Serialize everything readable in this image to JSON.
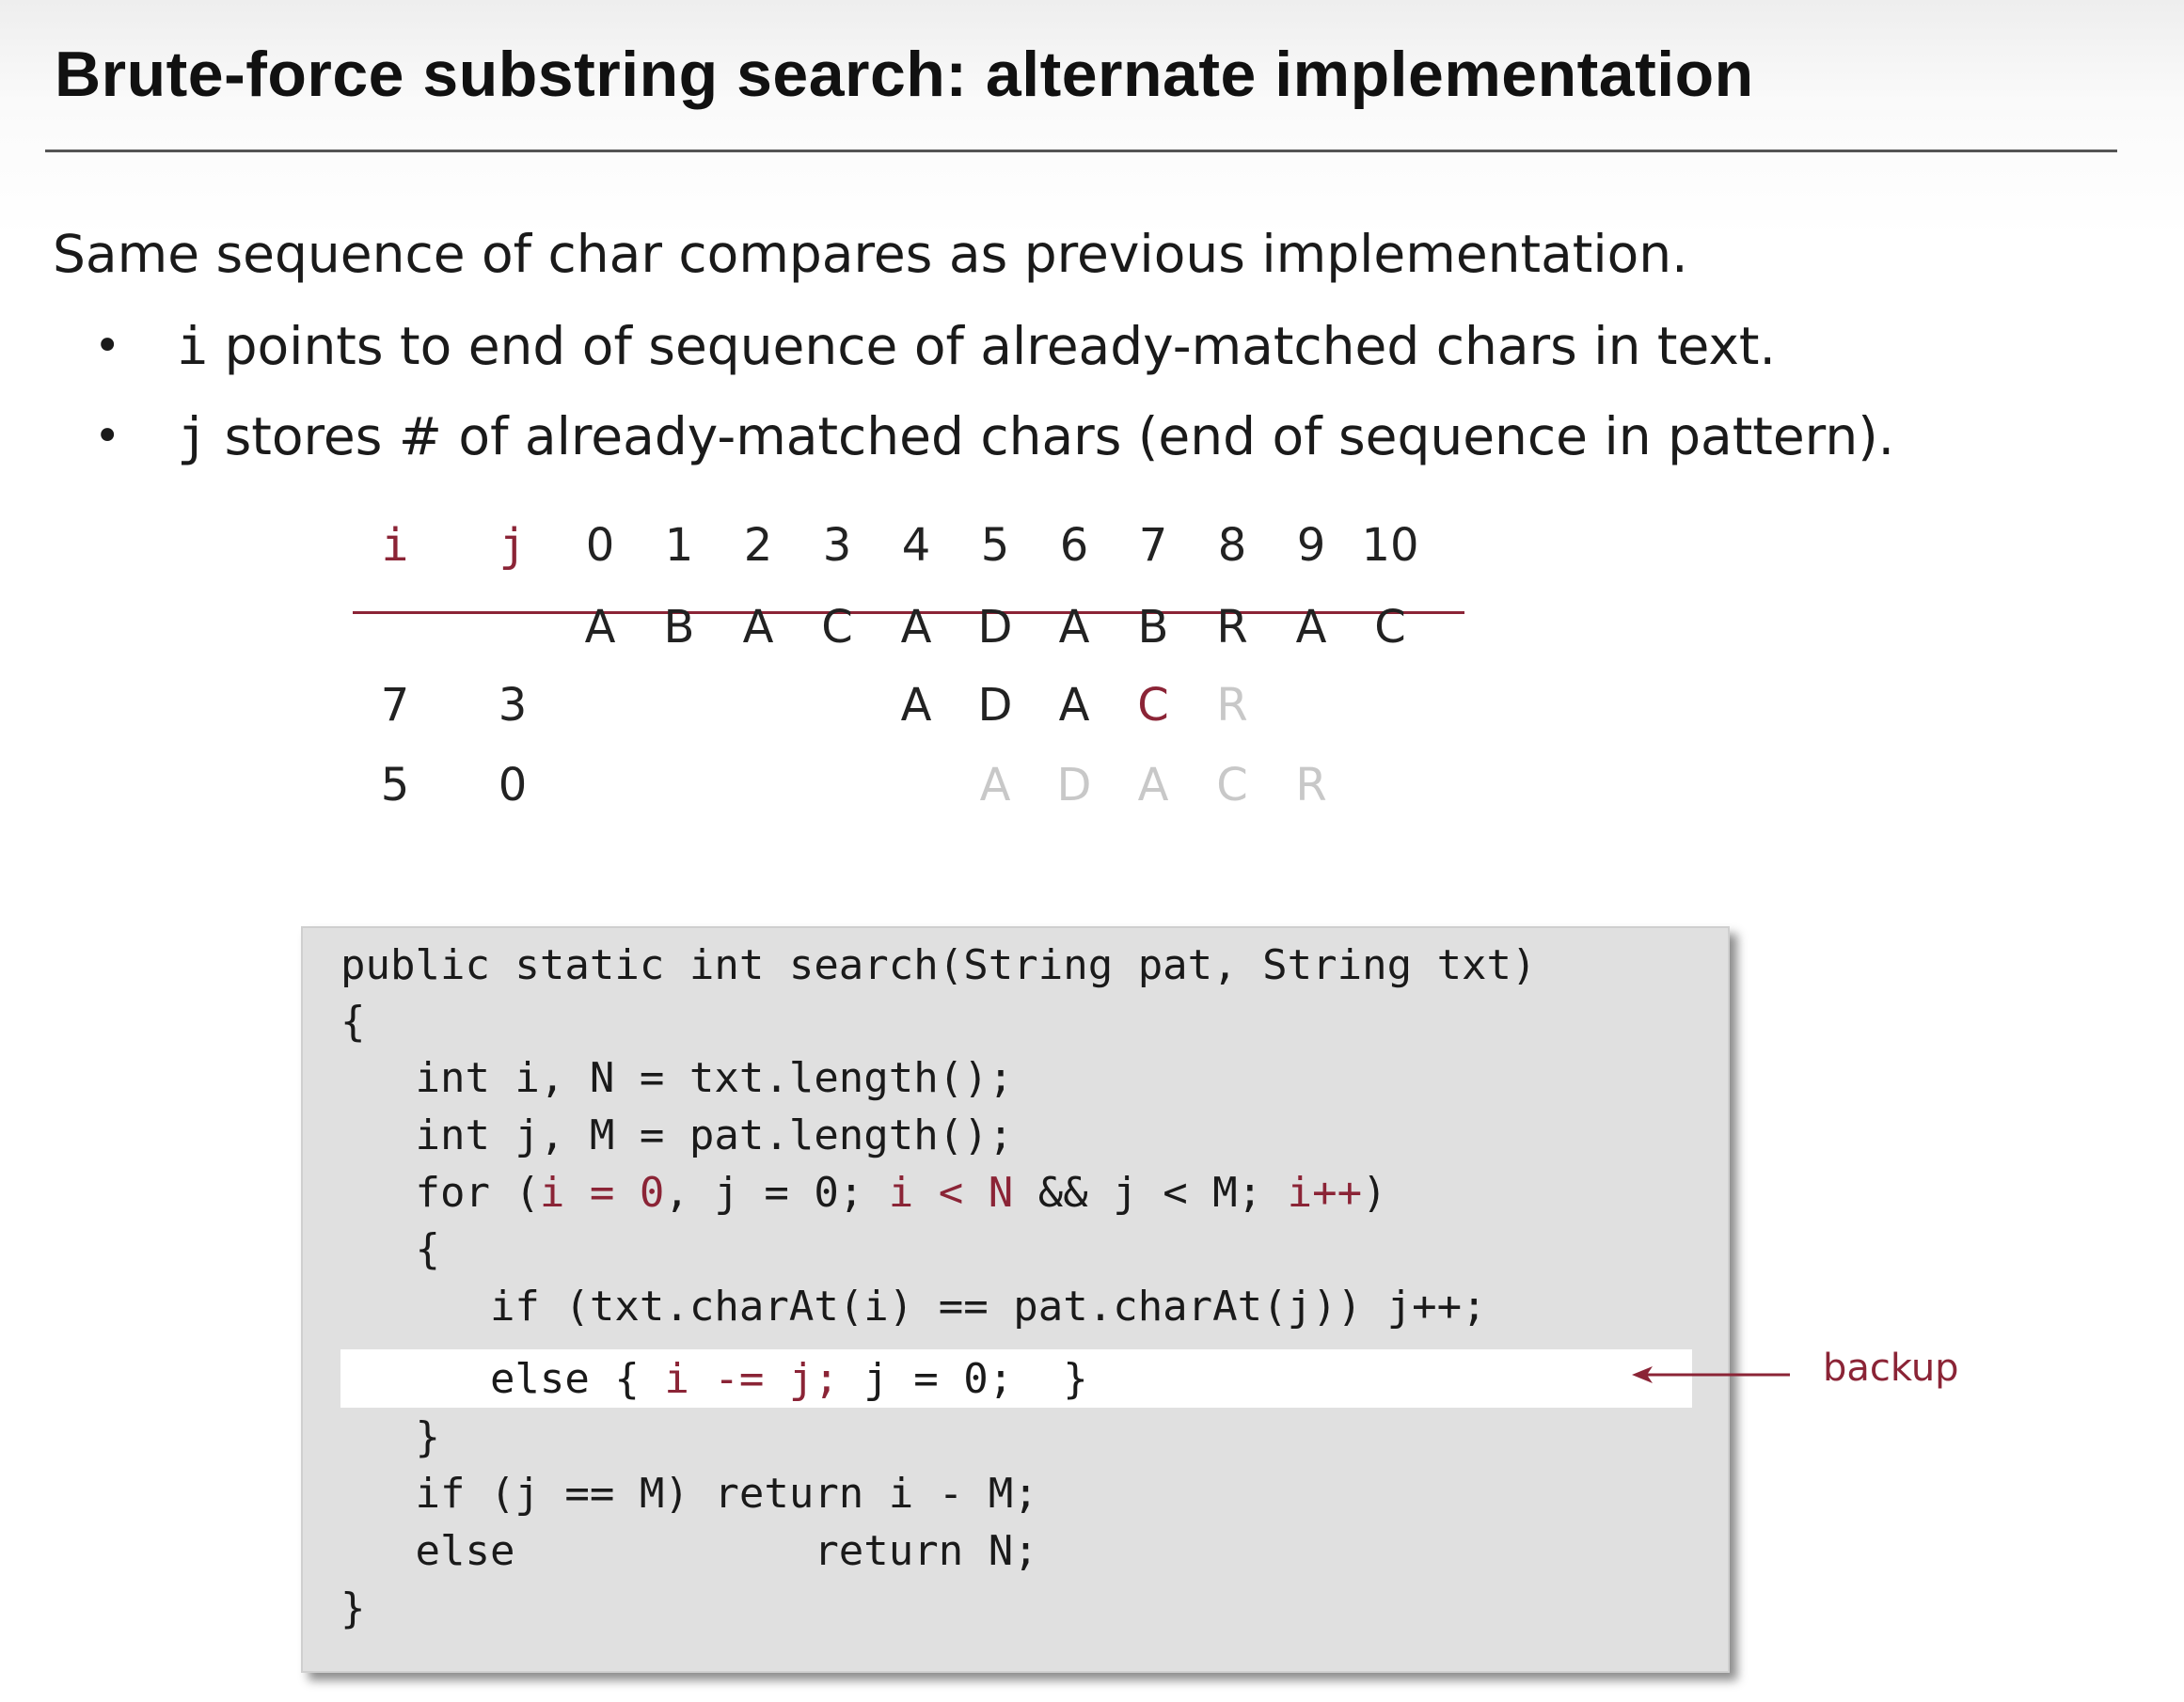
{
  "title": "Brute-force substring search:  alternate implementation",
  "intro": "Same sequence of char compares as previous implementation.",
  "bullets": [
    {
      "code": "i",
      "text": " points to end of sequence of already-matched chars in text."
    },
    {
      "code": "j",
      "text": " stores # of already-matched chars (end of sequence in pattern)."
    }
  ],
  "trace": {
    "header_i": "i",
    "header_j": "j",
    "indices": [
      "0",
      "1",
      "2",
      "3",
      "4",
      "5",
      "6",
      "7",
      "8",
      "9",
      "10"
    ],
    "text_chars": [
      "A",
      "B",
      "A",
      "C",
      "A",
      "D",
      "A",
      "B",
      "R",
      "A",
      "C"
    ],
    "rows": [
      {
        "i": "7",
        "j": "3",
        "chars": [
          {
            "pos": 4,
            "ch": "A",
            "state": "match"
          },
          {
            "pos": 5,
            "ch": "D",
            "state": "match"
          },
          {
            "pos": 6,
            "ch": "A",
            "state": "match"
          },
          {
            "pos": 7,
            "ch": "C",
            "state": "mismatch"
          },
          {
            "pos": 8,
            "ch": "R",
            "state": "faded"
          }
        ]
      },
      {
        "i": "5",
        "j": "0",
        "chars": [
          {
            "pos": 5,
            "ch": "A",
            "state": "faded"
          },
          {
            "pos": 6,
            "ch": "D",
            "state": "faded"
          },
          {
            "pos": 7,
            "ch": "A",
            "state": "faded"
          },
          {
            "pos": 8,
            "ch": "C",
            "state": "faded"
          },
          {
            "pos": 9,
            "ch": "R",
            "state": "faded"
          }
        ]
      }
    ],
    "colors": {
      "accent": "#8b2436",
      "faded": "#c8c8c8",
      "text": "#222222"
    }
  },
  "code": {
    "line1": "public static int search(String pat, String txt)",
    "line2": "{",
    "line3": "   int i, N = txt.length();",
    "line4": "   int j, M = pat.length();",
    "line5_a": "   for (",
    "line5_b": "i = 0",
    "line5_c": ", j = 0; ",
    "line5_d": "i < N",
    "line5_e": " && j < M; ",
    "line5_f": "i++",
    "line5_g": ")",
    "line6": "   {",
    "line7": "      if (txt.charAt(i) == pat.charAt(j)) j++;",
    "line8_a": "      else { ",
    "line8_b": "i -= j;",
    "line8_c": " j = 0;  }",
    "line9": "   }",
    "line10": "   if (j == M) return i - M;",
    "line11": "   else            return N;",
    "line12": "}",
    "highlight_color": "#ffffff",
    "panel_color": "#e0e0e0"
  },
  "annotation": {
    "label": "backup",
    "icon": "left-arrow-icon"
  }
}
